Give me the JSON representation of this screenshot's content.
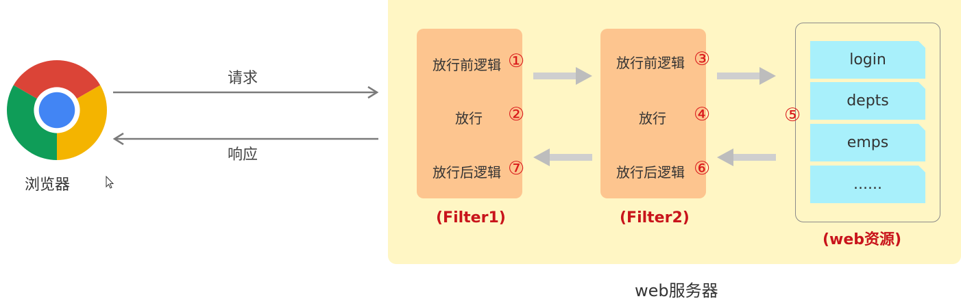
{
  "browser": {
    "label": "浏览器",
    "icon": "chrome-icon"
  },
  "request": {
    "label": "请求"
  },
  "response": {
    "label": "响应"
  },
  "server": {
    "label": "web服务器"
  },
  "filters": [
    {
      "name": "(Filter1)",
      "before": {
        "text": "放行前逻辑",
        "num": "①"
      },
      "pass": {
        "text": "放行",
        "num": "②"
      },
      "after": {
        "text": "放行后逻辑",
        "num": "⑦"
      }
    },
    {
      "name": "(Filter2)",
      "before": {
        "text": "放行前逻辑",
        "num": "③"
      },
      "pass": {
        "text": "放行",
        "num": "④"
      },
      "after": {
        "text": "放行后逻辑",
        "num": "⑥"
      }
    }
  ],
  "web": {
    "name": "(web资源)",
    "num": "⑤",
    "resources": [
      "login",
      "depts",
      "emps",
      "......"
    ]
  },
  "colors": {
    "server_bg": "#fff6c4",
    "filter_bg": "#fdc58f",
    "resource_bg": "#a8f0fb",
    "accent_red": "#d9191b"
  }
}
